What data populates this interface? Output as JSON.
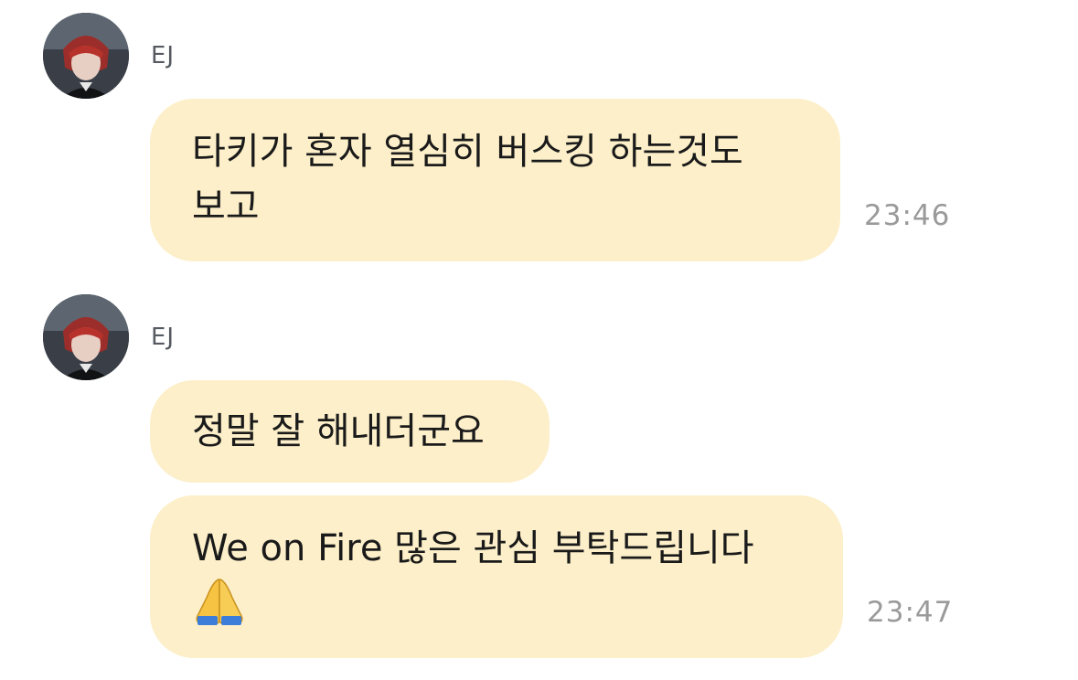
{
  "messages": [
    {
      "sender": "EJ",
      "bubbles": [
        {
          "lines": [
            "타키가 혼자 열심히 버스킹 하는것도",
            "보고"
          ],
          "time": "23:46"
        }
      ]
    },
    {
      "sender": "EJ",
      "bubbles": [
        {
          "lines": [
            "정말 잘 해내더군요"
          ],
          "time": ""
        },
        {
          "lines": [
            "We on Fire 많은 관심 부탁드립니다"
          ],
          "emoji": "folded-hands-icon",
          "time": "23:47"
        }
      ]
    }
  ],
  "colors": {
    "bubble": "#fcefc9",
    "timestamp": "#9a9a9a",
    "sender": "#555a60"
  }
}
